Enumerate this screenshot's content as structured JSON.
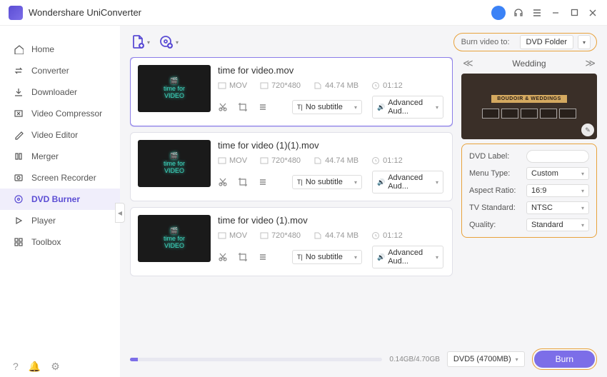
{
  "app_title": "Wondershare UniConverter",
  "sidebar": {
    "items": [
      {
        "icon": "home",
        "label": "Home"
      },
      {
        "icon": "convert",
        "label": "Converter"
      },
      {
        "icon": "download",
        "label": "Downloader"
      },
      {
        "icon": "compress",
        "label": "Video Compressor"
      },
      {
        "icon": "editor",
        "label": "Video Editor"
      },
      {
        "icon": "merge",
        "label": "Merger"
      },
      {
        "icon": "record",
        "label": "Screen Recorder"
      },
      {
        "icon": "dvd",
        "label": "DVD Burner"
      },
      {
        "icon": "play",
        "label": "Player"
      },
      {
        "icon": "toolbox",
        "label": "Toolbox"
      }
    ],
    "active_index": 7
  },
  "burn_to_label": "Burn video to:",
  "destination": "DVD Folder",
  "files": [
    {
      "name": "time for video.mov",
      "format": "MOV",
      "resolution": "720*480",
      "size": "44.74 MB",
      "duration": "01:12",
      "subtitle": "No subtitle",
      "audio": "Advanced Aud..."
    },
    {
      "name": "time for video (1)(1).mov",
      "format": "MOV",
      "resolution": "720*480",
      "size": "44.74 MB",
      "duration": "01:12",
      "subtitle": "No subtitle",
      "audio": "Advanced Aud..."
    },
    {
      "name": "time for video (1).mov",
      "format": "MOV",
      "resolution": "720*480",
      "size": "44.74 MB",
      "duration": "01:12",
      "subtitle": "No subtitle",
      "audio": "Advanced Aud..."
    }
  ],
  "thumb_text_top": "time for",
  "thumb_text_bot": "VIDEO",
  "template": {
    "name": "Wedding",
    "banner": "BOUDOIR & WEDDINGS"
  },
  "settings": {
    "label_label": "DVD Label:",
    "label_value": "",
    "menu_label": "Menu Type:",
    "menu_value": "Custom",
    "aspect_label": "Aspect Ratio:",
    "aspect_value": "16:9",
    "tv_label": "TV Standard:",
    "tv_value": "NTSC",
    "quality_label": "Quality:",
    "quality_value": "Standard"
  },
  "progress_text": "0.14GB/4.70GB",
  "disc_type": "DVD5 (4700MB)",
  "burn_label": "Burn"
}
